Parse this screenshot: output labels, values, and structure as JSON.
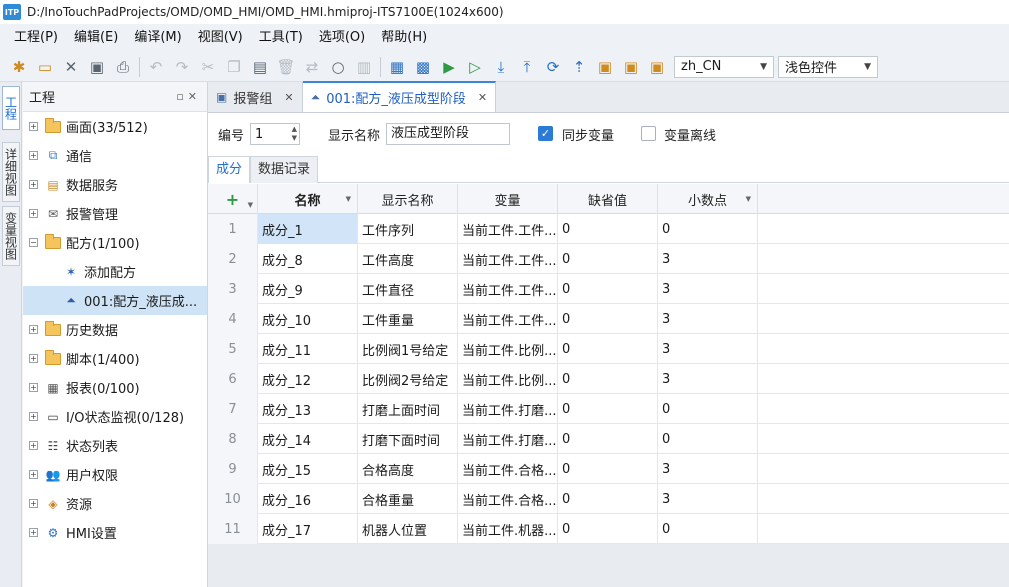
{
  "window": {
    "logo_text": "ITP",
    "title": "D:/InoTouchPadProjects/OMD/OMD_HMI/OMD_HMI.hmiproj-ITS7100E(1024x600)"
  },
  "menu": [
    "工程(P)",
    "编辑(E)",
    "编译(M)",
    "视图(V)",
    "工具(T)",
    "选项(O)",
    "帮助(H)"
  ],
  "toolbar": {
    "language": "zh_CN",
    "theme": "浅色控件"
  },
  "side_tabs": [
    "工程",
    "详细视图",
    "变量视图"
  ],
  "project_panel": {
    "title": "工程",
    "items": [
      {
        "label": "画面(33/512)",
        "icon": "folder-icon"
      },
      {
        "label": "通信",
        "icon": "communication-icon"
      },
      {
        "label": "数据服务",
        "icon": "data-service-icon"
      },
      {
        "label": "报警管理",
        "icon": "alarm-icon"
      },
      {
        "label": "配方(1/100)",
        "icon": "recipe-folder-icon"
      },
      {
        "label": "添加配方",
        "icon": "add-recipe-icon"
      },
      {
        "label": "001:配方_液压成...",
        "icon": "recipe-flask-icon"
      },
      {
        "label": "历史数据",
        "icon": "history-folder-icon"
      },
      {
        "label": "脚本(1/400)",
        "icon": "script-folder-icon"
      },
      {
        "label": "报表(0/100)",
        "icon": "report-icon"
      },
      {
        "label": "I/O状态监视(0/128)",
        "icon": "io-monitor-icon"
      },
      {
        "label": "状态列表",
        "icon": "status-list-icon"
      },
      {
        "label": "用户权限",
        "icon": "users-icon"
      },
      {
        "label": "资源",
        "icon": "resource-icon"
      },
      {
        "label": "HMI设置",
        "icon": "hmi-settings-icon"
      }
    ]
  },
  "doc_tabs": [
    {
      "label": "报警组",
      "icon": "alarm-group-icon"
    },
    {
      "label": "001:配方_液压成型阶段",
      "icon": "recipe-flask-icon"
    }
  ],
  "recipe": {
    "number_label": "编号",
    "number_value": "1",
    "display_name_label": "显示名称",
    "display_name_value": "液压成型阶段",
    "sync_var_label": "同步变量",
    "offline_var_label": "变量离线"
  },
  "subtabs": [
    "成分",
    "数据记录"
  ],
  "grid": {
    "add_symbol": "+",
    "columns": [
      "名称",
      "显示名称",
      "变量",
      "缺省值",
      "小数点"
    ],
    "rows": [
      [
        "1",
        "成分_1",
        "工件序列",
        "当前工件.工件...",
        "0",
        "0"
      ],
      [
        "2",
        "成分_8",
        "工件高度",
        "当前工件.工件...",
        "0",
        "3"
      ],
      [
        "3",
        "成分_9",
        "工件直径",
        "当前工件.工件...",
        "0",
        "3"
      ],
      [
        "4",
        "成分_10",
        "工件重量",
        "当前工件.工件...",
        "0",
        "3"
      ],
      [
        "5",
        "成分_11",
        "比例阀1号给定",
        "当前工件.比例...",
        "0",
        "3"
      ],
      [
        "6",
        "成分_12",
        "比例阀2号给定",
        "当前工件.比例...",
        "0",
        "3"
      ],
      [
        "7",
        "成分_13",
        "打磨上面时间",
        "当前工件.打磨...",
        "0",
        "0"
      ],
      [
        "8",
        "成分_14",
        "打磨下面时间",
        "当前工件.打磨...",
        "0",
        "0"
      ],
      [
        "9",
        "成分_15",
        "合格高度",
        "当前工件.合格...",
        "0",
        "3"
      ],
      [
        "10",
        "成分_16",
        "合格重量",
        "当前工件.合格...",
        "0",
        "3"
      ],
      [
        "11",
        "成分_17",
        "机器人位置",
        "当前工件.机器...",
        "0",
        "0"
      ]
    ]
  }
}
